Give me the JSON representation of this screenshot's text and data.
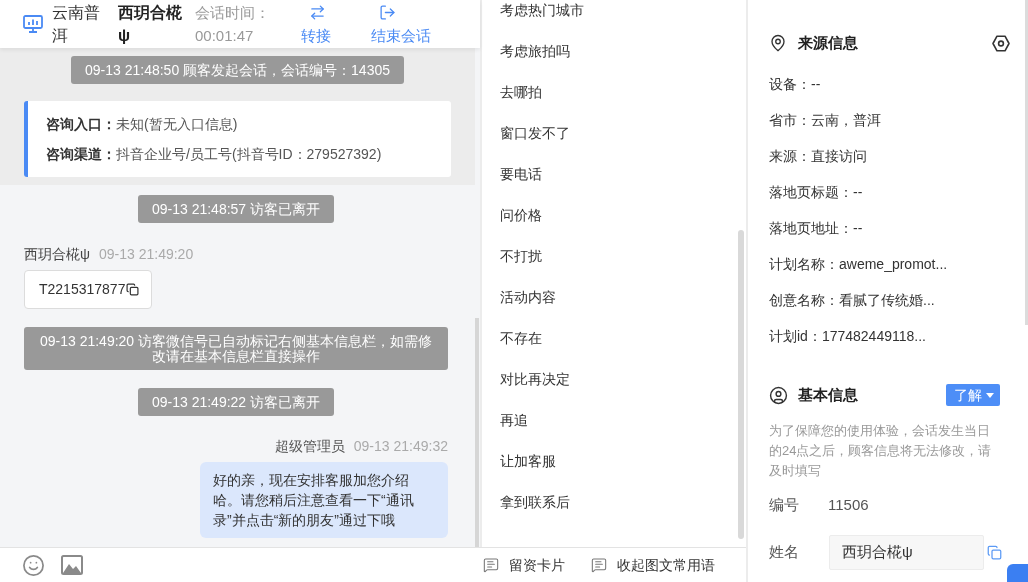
{
  "header": {
    "location": "云南普洱",
    "visitor_name": "西玥合椛ψ",
    "session_time_label": "会话时间：",
    "session_time": "00:01:47",
    "actions": [
      {
        "kind": "transfer",
        "label": "转接"
      },
      {
        "kind": "end",
        "label": "结束会话"
      }
    ]
  },
  "session_start": [
    {
      "kind": "system",
      "text": "09-13 21:48:50 顾客发起会话，会话编号：14305"
    },
    {
      "kind": "info",
      "lines": [
        "**咨询入口：**未知(暂无入口信息)",
        "**咨询渠道：**抖音企业号/员工号(抖音号ID：279527392)"
      ]
    }
  ],
  "messages": [
    {
      "kind": "system",
      "text": "09-13 21:48:57 访客已离开"
    },
    {
      "kind": "visitor",
      "sender": "西玥合椛ψ",
      "time": "09-13 21:49:20",
      "text": "T2215317877"
    },
    {
      "kind": "system",
      "text": "09-13 21:49:20 访客微信号已自动标记右侧基本信息栏，如需修改请在基本信息栏直接操作"
    },
    {
      "kind": "system",
      "text": "09-13 21:49:22 访客已离开"
    },
    {
      "kind": "agent",
      "sender": "超级管理员",
      "time": "09-13 21:49:32",
      "text": "好的亲，现在安排客服加您介绍哈。请您稍后注意查看一下“通讯录”并点击“新的朋友”通过下哦"
    }
  ],
  "phrases": {
    "items": [
      "考虑热门城市",
      "考虑旅拍吗",
      "去哪拍",
      "窗口发不了",
      "要电话",
      "问价格",
      "不打扰",
      "活动内容",
      "不存在",
      "对比再决定",
      "再追",
      "让加客服",
      "拿到联系后"
    ],
    "footer_actions": [
      "留资卡片",
      "收起图文常用语"
    ]
  },
  "source_info": {
    "title": "来源信息",
    "rows": [
      "设备：--",
      "省市：云南，普洱",
      "来源：直接访问",
      "落地页标题：--",
      "落地页地址：--",
      "计划名称：aweme_promot...",
      "创意名称：看腻了传统婚...",
      "计划id：177482449118..."
    ]
  },
  "basic_info": {
    "title": "基本信息",
    "dropdown": "了解",
    "note": "为了保障您的使用体验，会话发生当日的24点之后，顾客信息将无法修改，请及时填写",
    "fields": [
      {
        "kind": "text",
        "label": "编号",
        "value": "11506"
      },
      {
        "kind": "input",
        "label": "姓名",
        "value": "西玥合椛ψ"
      }
    ]
  }
}
